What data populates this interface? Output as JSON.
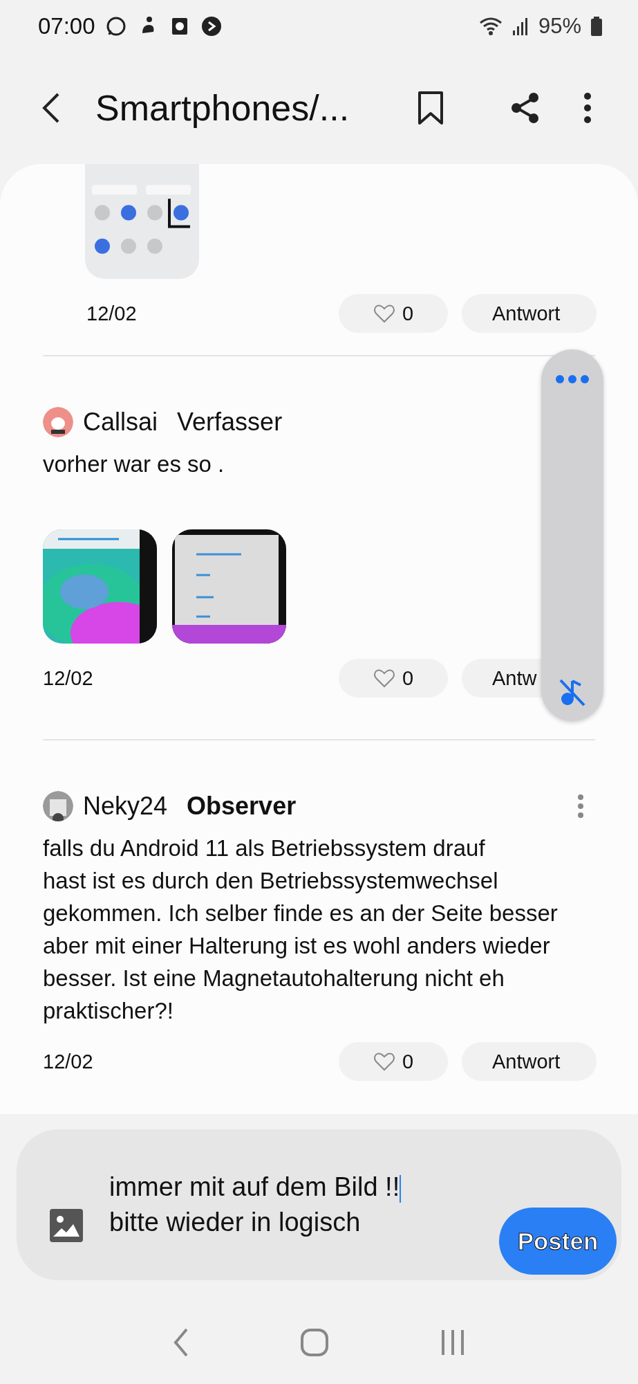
{
  "status_bar": {
    "time": "07:00",
    "battery": "95%"
  },
  "header": {
    "title": "Smartphones/..."
  },
  "posts": [
    {
      "cut_top": true,
      "pictures": [
        {
          "kind": "picture"
        }
      ],
      "date": "12/02",
      "likes": "0",
      "reply": "Antwort"
    },
    {
      "author": "Callsai",
      "role": "Verfasser",
      "role_bold": false,
      "lines": [
        "vorher war es so ."
      ],
      "pictures": [
        {
          "kind": "picture"
        },
        {
          "kind": "picture"
        }
      ],
      "date": "12/02",
      "likes": "0",
      "reply": "Antw"
    },
    {
      "author": "Neky24",
      "role": "Observer",
      "role_bold": true,
      "lines": [
        "falls du Android 11 als Betriebssystem drauf",
        "hast ist es durch den Betriebssystemwechsel",
        "gekommen. Ich selber finde es an der Seite besser",
        "aber mit einer Halterung ist es wohl anders wieder",
        "besser. Ist eine Magnetautohalterung nicht eh",
        "praktischer?!"
      ],
      "more_menu": true,
      "date": "12/02",
      "likes": "0",
      "reply": "Antwort"
    }
  ],
  "composer": {
    "lines": [
      "immer mit auf dem Bild !!",
      "bitte wieder in logisch"
    ],
    "post_button": "Posten"
  }
}
